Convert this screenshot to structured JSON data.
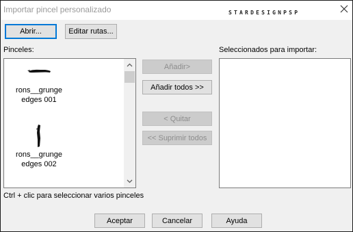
{
  "window": {
    "title": "Importar pincel personalizado",
    "watermark": "STARDESIGNPSP"
  },
  "toolbar": {
    "open_label": "Abrir...",
    "edit_paths_label": "Editar rutas..."
  },
  "brushes": {
    "label": "Pinceles:",
    "items": [
      {
        "line1": "rons__grunge",
        "line2": "edges 001"
      },
      {
        "line1": "rons__grunge",
        "line2": "edges 002"
      }
    ]
  },
  "actions": {
    "add_label": "Añadir>",
    "add_all_label": "Añadir todos >>",
    "remove_label": "< Quitar",
    "remove_all_label": "<< Suprimir todos"
  },
  "selected": {
    "label": "Seleccionados para importar:"
  },
  "hint": "Ctrl + clic para seleccionar varios pinceles",
  "footer": {
    "accept_label": "Aceptar",
    "cancel_label": "Cancelar",
    "help_label": "Ayuda"
  },
  "colors": {
    "focus_border": "#0078d7",
    "disabled_text": "#8d8d8d",
    "dialog_bg": "#f0f0f0"
  },
  "icons": [
    "close-icon",
    "scroll-up-icon",
    "scroll-down-icon"
  ]
}
